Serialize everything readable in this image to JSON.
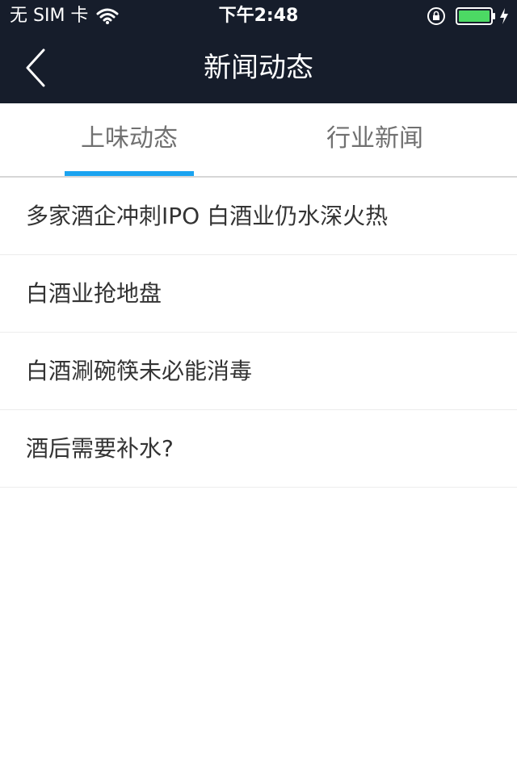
{
  "status_bar": {
    "carrier": "无 SIM 卡",
    "time": "下午2:48",
    "icons": [
      "wifi-icon",
      "rotation-lock-icon",
      "battery-icon",
      "charging-icon"
    ],
    "battery_color": "#4cd964"
  },
  "nav": {
    "title": "新闻动态",
    "back_icon": "chevron-left-icon",
    "background": "#161d2b"
  },
  "tabs": [
    {
      "label": "上味动态",
      "selected": true
    },
    {
      "label": "行业新闻",
      "selected": false
    }
  ],
  "tab_indicator_color": "#1aa3f0",
  "news": [
    {
      "title": "多家酒企冲刺IPO 白酒业仍水深火热"
    },
    {
      "title": "白酒业抢地盘"
    },
    {
      "title": "白酒涮碗筷未必能消毒"
    },
    {
      "title": "酒后需要补水?"
    }
  ]
}
